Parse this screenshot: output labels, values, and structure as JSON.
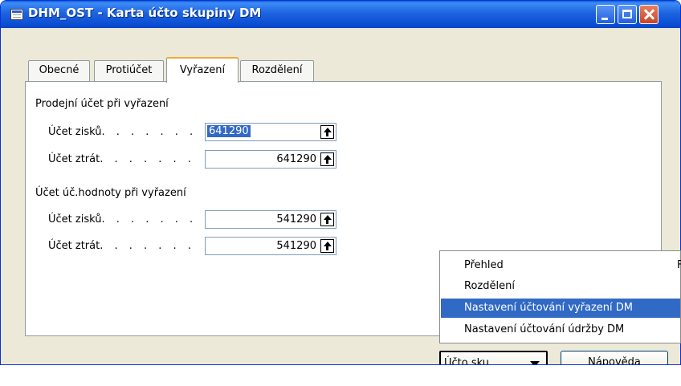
{
  "window": {
    "title": "DHM_OST - Karta účto skupiny DM"
  },
  "tabs": [
    {
      "label": "Obecné"
    },
    {
      "label": "Protiúčet"
    },
    {
      "label": "Vyřazení"
    },
    {
      "label": "Rozdělení"
    }
  ],
  "active_tab": "Vyřazení",
  "sale_section": {
    "heading": "Prodejní účet při vyřazení",
    "gain_label": "Účet zisků",
    "gain_value": "641290",
    "loss_label": "Účet ztrát",
    "loss_value": "641290"
  },
  "bookvalue_section": {
    "heading": "Účet úč.hodnoty při vyřazení",
    "gain_label": "Účet zisků",
    "gain_value": "541290",
    "loss_label": "Účet ztrát",
    "loss_value": "541290"
  },
  "dots": ". . . . . . .",
  "menu": {
    "items": [
      {
        "label": "Přehled",
        "shortcut": "F"
      },
      {
        "label": "Rozdělení",
        "shortcut": ""
      },
      {
        "label": "Nastavení účtování vyřazení DM",
        "shortcut": ""
      },
      {
        "label": "Nastavení účtování údržby DM",
        "shortcut": ""
      }
    ],
    "highlighted_index": 2
  },
  "buttons": {
    "menu_button": "Účto sku...",
    "help": "Nápověda"
  }
}
